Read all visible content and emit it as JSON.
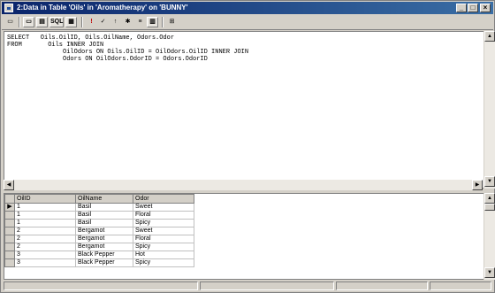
{
  "window": {
    "title": "2:Data in Table 'Oils' in 'Aromatherapy' on 'BUNNY'",
    "controls": {
      "minimize": "_",
      "maximize": "□",
      "close": "×"
    }
  },
  "toolbar": {
    "sql_label": "SQL",
    "exec_icon": "exclamation-icon"
  },
  "sql": {
    "lines": [
      "SELECT   Oils.OilID, Oils.OilName, Odors.Odor",
      "FROM       Oils INNER JOIN",
      "               OilOdors ON Oils.OilID = OilOdors.OilID INNER JOIN",
      "               Odors ON OilOdors.OdorID = Odors.OdorID"
    ]
  },
  "grid": {
    "columns": [
      "OilID",
      "OilName",
      "Odor"
    ],
    "rows": [
      [
        "1",
        "Basil",
        "Sweet"
      ],
      [
        "1",
        "Basil",
        "Floral"
      ],
      [
        "1",
        "Basil",
        "Spicy"
      ],
      [
        "2",
        "Bergamot",
        "Sweet"
      ],
      [
        "2",
        "Bergamot",
        "Floral"
      ],
      [
        "2",
        "Bergamot",
        "Spicy"
      ],
      [
        "3",
        "Black Pepper",
        "Hot"
      ],
      [
        "3",
        "Black Pepper",
        "Spicy"
      ]
    ],
    "current_row_indicator": "▶"
  },
  "colors": {
    "title_start": "#0a246a",
    "title_end": "#3a6ea5",
    "face": "#d4d0c8"
  }
}
